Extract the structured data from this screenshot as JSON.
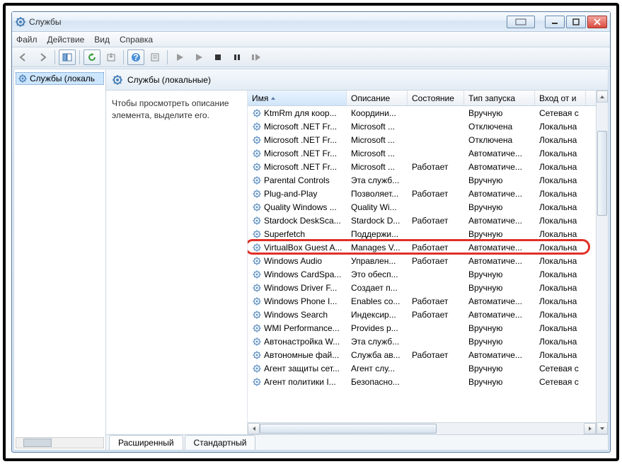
{
  "window": {
    "title": "Службы"
  },
  "menu": {
    "file": "Файл",
    "action": "Действие",
    "view": "Вид",
    "help": "Справка"
  },
  "tree": {
    "root": "Службы (локаль"
  },
  "mainHeader": {
    "title": "Службы (локальные)"
  },
  "desc": {
    "text": "Чтобы просмотреть описание элемента, выделите его."
  },
  "columns": {
    "name": "Имя",
    "description": "Описание",
    "state": "Состояние",
    "startup": "Тип запуска",
    "logon": "Вход от и"
  },
  "tabs": {
    "extended": "Расширенный",
    "standard": "Стандартный"
  },
  "highlightIndex": 10,
  "services": [
    {
      "name": "KtmRm для коор...",
      "desc": "Координи...",
      "state": "",
      "startup": "Вручную",
      "logon": "Сетевая с"
    },
    {
      "name": "Microsoft .NET Fr...",
      "desc": "Microsoft ...",
      "state": "",
      "startup": "Отключена",
      "logon": "Локальна"
    },
    {
      "name": "Microsoft .NET Fr...",
      "desc": "Microsoft ...",
      "state": "",
      "startup": "Отключена",
      "logon": "Локальна"
    },
    {
      "name": "Microsoft .NET Fr...",
      "desc": "Microsoft ...",
      "state": "",
      "startup": "Автоматиче...",
      "logon": "Локальна"
    },
    {
      "name": "Microsoft .NET Fr...",
      "desc": "Microsoft ...",
      "state": "Работает",
      "startup": "Автоматиче...",
      "logon": "Локальна"
    },
    {
      "name": "Parental Controls",
      "desc": "Эта служб...",
      "state": "",
      "startup": "Вручную",
      "logon": "Локальна"
    },
    {
      "name": "Plug-and-Play",
      "desc": "Позволяет...",
      "state": "Работает",
      "startup": "Автоматиче...",
      "logon": "Локальна"
    },
    {
      "name": "Quality Windows ...",
      "desc": "Quality Wi...",
      "state": "",
      "startup": "Вручную",
      "logon": "Локальна"
    },
    {
      "name": "Stardock DeskSca...",
      "desc": "Stardock D...",
      "state": "Работает",
      "startup": "Автоматиче...",
      "logon": "Локальна"
    },
    {
      "name": "Superfetch",
      "desc": "Поддержи...",
      "state": "",
      "startup": "Вручную",
      "logon": "Локальна"
    },
    {
      "name": "VirtualBox Guest A...",
      "desc": "Manages V...",
      "state": "Работает",
      "startup": "Автоматиче...",
      "logon": "Локальна"
    },
    {
      "name": "Windows Audio",
      "desc": "Управлен...",
      "state": "Работает",
      "startup": "Автоматиче...",
      "logon": "Локальна"
    },
    {
      "name": "Windows CardSpa...",
      "desc": "Это обесп...",
      "state": "",
      "startup": "Вручную",
      "logon": "Локальна"
    },
    {
      "name": "Windows Driver F...",
      "desc": "Создает п...",
      "state": "",
      "startup": "Вручную",
      "logon": "Локальна"
    },
    {
      "name": "Windows Phone I...",
      "desc": "Enables co...",
      "state": "Работает",
      "startup": "Автоматиче...",
      "logon": "Локальна"
    },
    {
      "name": "Windows Search",
      "desc": "Индексир...",
      "state": "Работает",
      "startup": "Автоматиче...",
      "logon": "Локальна"
    },
    {
      "name": "WMI Performance...",
      "desc": "Provides p...",
      "state": "",
      "startup": "Вручную",
      "logon": "Локальна"
    },
    {
      "name": "Автонастройка W...",
      "desc": "Эта служб...",
      "state": "",
      "startup": "Вручную",
      "logon": "Локальна"
    },
    {
      "name": "Автономные фай...",
      "desc": "Служба ав...",
      "state": "Работает",
      "startup": "Автоматиче...",
      "logon": "Локальна"
    },
    {
      "name": "Агент защиты сет...",
      "desc": "Агент слу...",
      "state": "",
      "startup": "Вручную",
      "logon": "Сетевая с"
    },
    {
      "name": "Агент политики I...",
      "desc": "Безопасно...",
      "state": "",
      "startup": "Вручную",
      "logon": "Сетевая с"
    }
  ]
}
